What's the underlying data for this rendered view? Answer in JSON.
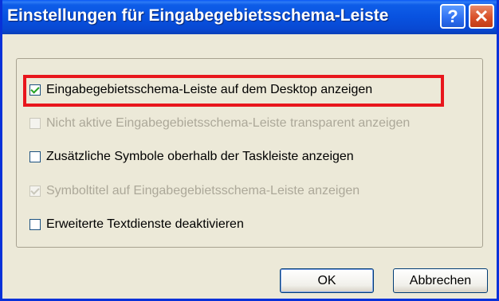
{
  "window": {
    "title": "Einstellungen für Eingabegebietsschema-Leiste",
    "help_label": "?",
    "close_label": "✕"
  },
  "options": [
    {
      "label": "Eingabegebietsschema-Leiste auf dem Desktop anzeigen",
      "checked": true,
      "enabled": true
    },
    {
      "label": "Nicht aktive Eingabegebietsschema-Leiste transparent anzeigen",
      "checked": false,
      "enabled": false
    },
    {
      "label": "Zusätzliche Symbole oberhalb der Taskleiste anzeigen",
      "checked": false,
      "enabled": true
    },
    {
      "label": "Symboltitel auf Eingabegebietsschema-Leiste anzeigen",
      "checked": true,
      "enabled": false
    },
    {
      "label": "Erweiterte Textdienste deaktivieren",
      "checked": false,
      "enabled": true
    }
  ],
  "buttons": {
    "ok_label": "OK",
    "cancel_label": "Abbrechen"
  },
  "colors": {
    "titlebar": "#0852E0",
    "highlight": "#E8161C",
    "checkmark": "#21A121",
    "disabled_text": "#ACA899"
  }
}
